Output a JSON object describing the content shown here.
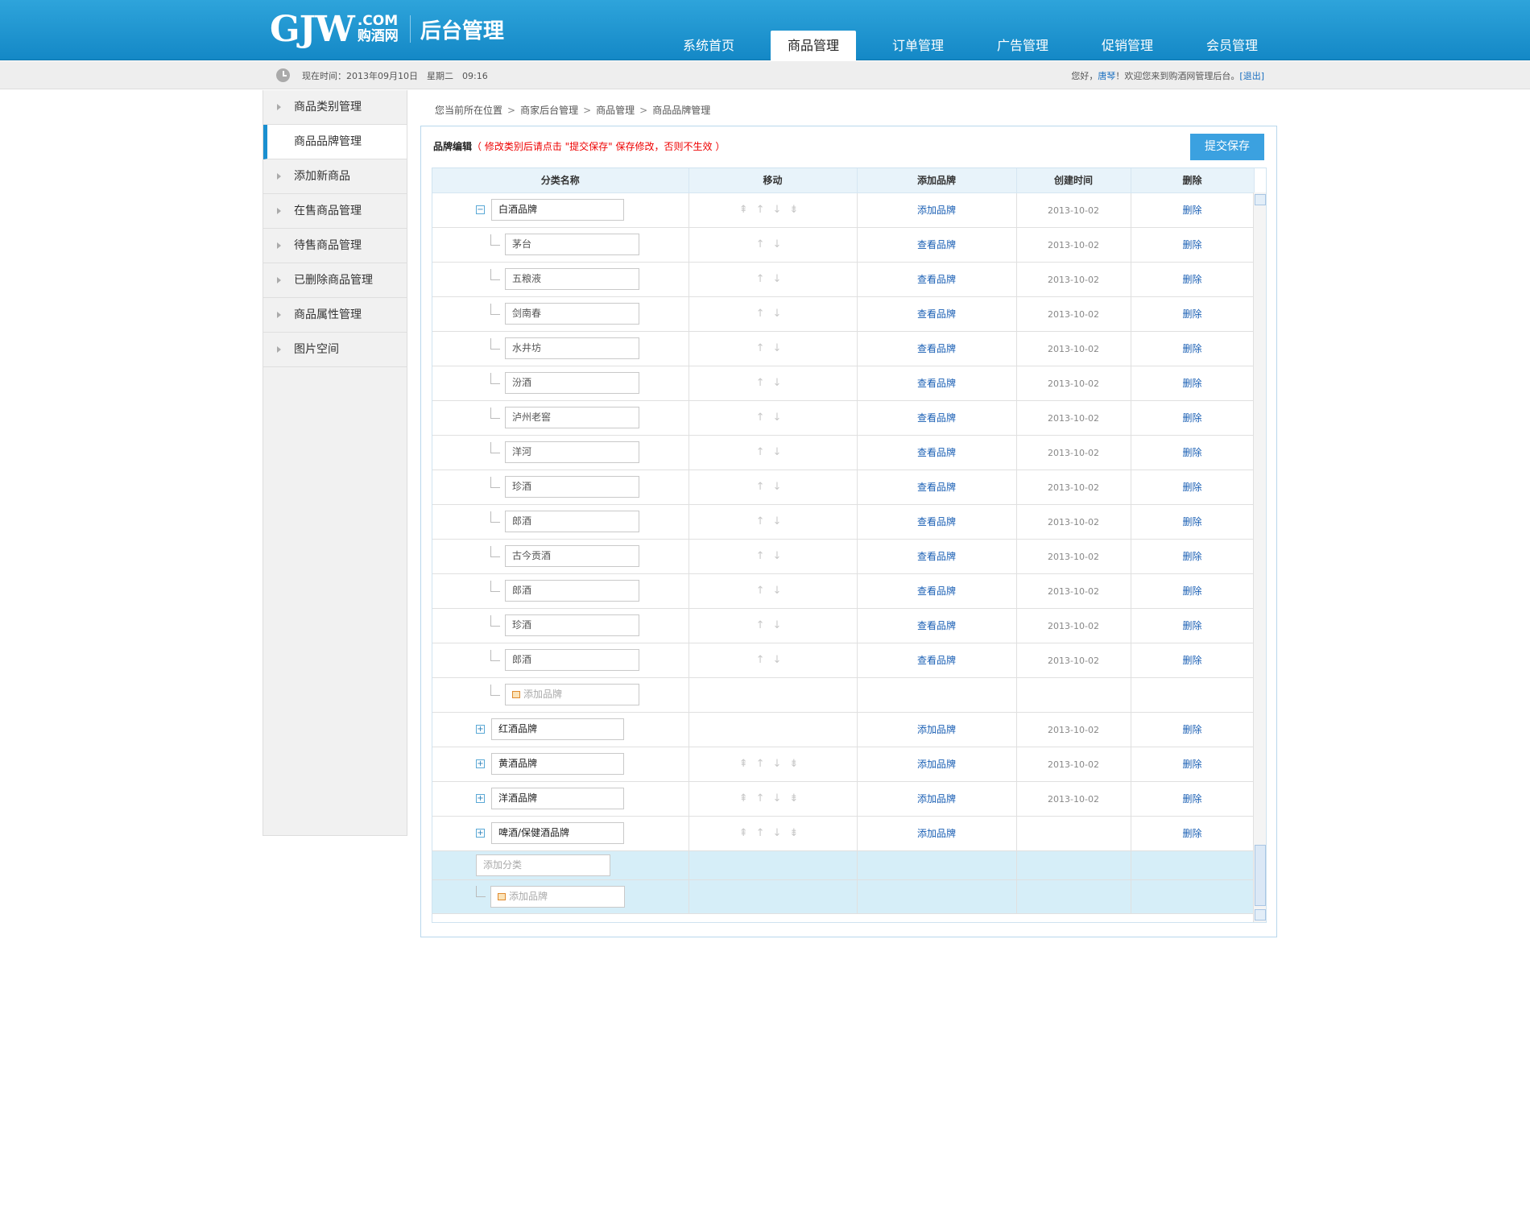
{
  "header": {
    "logo_main": "GJW",
    "logo_com": ".COM",
    "logo_cn": "购酒网",
    "logo_sub": "后台管理",
    "nav": [
      "系统首页",
      "商品管理",
      "订单管理",
      "广告管理",
      "促销管理",
      "会员管理"
    ],
    "nav_active": 1
  },
  "topbar": {
    "time_label": "现在时间：2013年09月10日　星期二　09:16",
    "greet_prefix": "您好，",
    "user": "唐琴",
    "greet_suffix": "！欢迎您来到购酒网管理后台。",
    "logout": "[退出]"
  },
  "sidebar": {
    "items": [
      "商品类别管理",
      "商品品牌管理",
      "添加新商品",
      "在售商品管理",
      "待售商品管理",
      "已删除商品管理",
      "商品属性管理",
      "图片空间"
    ],
    "active": 1
  },
  "breadcrumb": [
    "您当前所在位置",
    "商家后台管理",
    "商品管理",
    "商品品牌管理"
  ],
  "panel": {
    "title": "品牌编辑",
    "warn": "（ 修改类别后请点击 \"提交保存\" 保存修改，否则不生效 ）",
    "save": "提交保存"
  },
  "table": {
    "headers": [
      "分类名称",
      "移动",
      "添加品牌",
      "创建时间",
      "删除"
    ],
    "rows": [
      {
        "type": "parent",
        "expand": "−",
        "name": "白酒品牌",
        "arrows": "⇞↑↓⇟",
        "link": "添加品牌",
        "date": "2013-10-02",
        "del": "删除"
      },
      {
        "type": "child",
        "name": "茅台",
        "arrows": "↑↓",
        "link": "查看品牌",
        "date": "2013-10-02",
        "del": "删除"
      },
      {
        "type": "child",
        "name": "五粮液",
        "arrows": "↑↓",
        "link": "查看品牌",
        "date": "2013-10-02",
        "del": "删除"
      },
      {
        "type": "child",
        "name": "剑南春",
        "arrows": "↑↓",
        "link": "查看品牌",
        "date": "2013-10-02",
        "del": "删除"
      },
      {
        "type": "child",
        "name": "水井坊",
        "arrows": "↑↓",
        "link": "查看品牌",
        "date": "2013-10-02",
        "del": "删除"
      },
      {
        "type": "child",
        "name": "汾酒",
        "arrows": "↑↓",
        "link": "查看品牌",
        "date": "2013-10-02",
        "del": "删除"
      },
      {
        "type": "child",
        "name": "泸州老窖",
        "arrows": "↑↓",
        "link": "查看品牌",
        "date": "2013-10-02",
        "del": "删除"
      },
      {
        "type": "child",
        "name": "洋河",
        "arrows": "↑↓",
        "link": "查看品牌",
        "date": "2013-10-02",
        "del": "删除"
      },
      {
        "type": "child",
        "name": "珍酒",
        "arrows": "↑↓",
        "link": "查看品牌",
        "date": "2013-10-02",
        "del": "删除"
      },
      {
        "type": "child",
        "name": "郎酒",
        "arrows": "↑↓",
        "link": "查看品牌",
        "date": "2013-10-02",
        "del": "删除"
      },
      {
        "type": "child",
        "name": "古今贡酒",
        "arrows": "↑↓",
        "link": "查看品牌",
        "date": "2013-10-02",
        "del": "删除"
      },
      {
        "type": "child",
        "name": "郎酒",
        "arrows": "↑↓",
        "link": "查看品牌",
        "date": "2013-10-02",
        "del": "删除"
      },
      {
        "type": "child",
        "name": "珍酒",
        "arrows": "↑↓",
        "link": "查看品牌",
        "date": "2013-10-02",
        "del": "删除"
      },
      {
        "type": "child",
        "name": "郎酒",
        "arrows": "↑↓",
        "link": "查看品牌",
        "date": "2013-10-02",
        "del": "删除"
      },
      {
        "type": "add_child",
        "name": "添加品牌"
      },
      {
        "type": "parent",
        "expand": "+",
        "name": "红酒品牌",
        "arrows": "",
        "link": "添加品牌",
        "date": "2013-10-02",
        "del": "删除"
      },
      {
        "type": "parent",
        "expand": "+",
        "name": "黄酒品牌",
        "arrows": "⇞↑↓⇟",
        "link": "添加品牌",
        "date": "2013-10-02",
        "del": "删除"
      },
      {
        "type": "parent",
        "expand": "+",
        "name": "洋酒品牌",
        "arrows": "⇞↑↓⇟",
        "link": "添加品牌",
        "date": "2013-10-02",
        "del": "删除"
      },
      {
        "type": "parent",
        "expand": "+",
        "name": "啤酒/保健酒品牌",
        "arrows": "⇞↑↓⇟",
        "link": "添加品牌",
        "date": "",
        "del": "删除"
      }
    ],
    "add_category": "添加分类",
    "add_brand": "添加品牌"
  }
}
